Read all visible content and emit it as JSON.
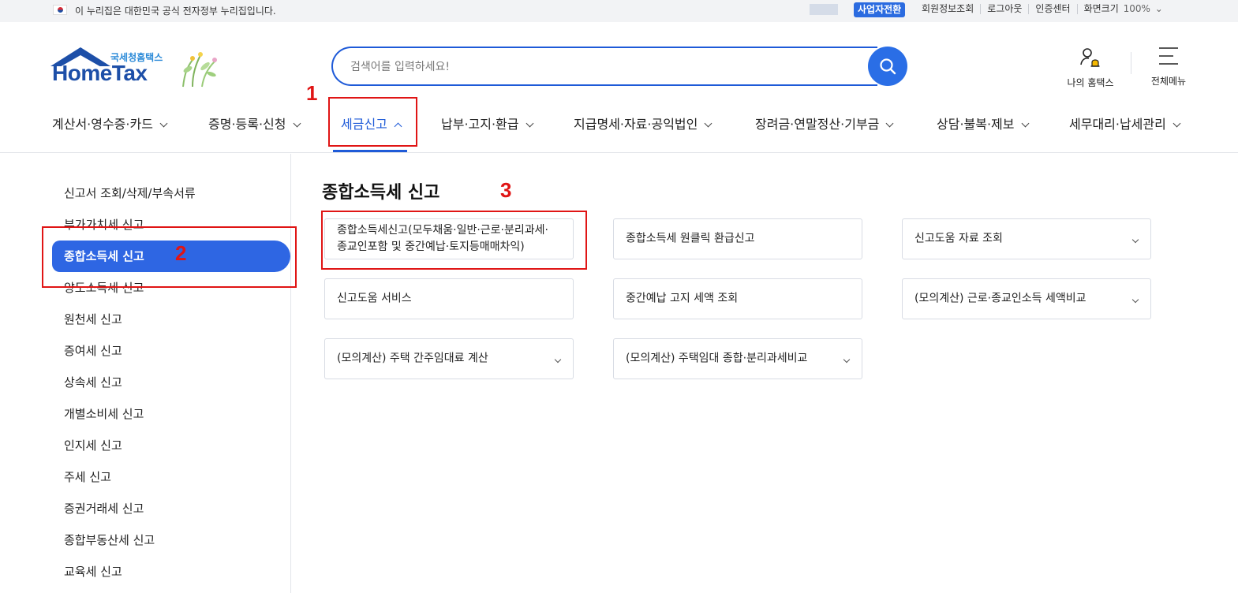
{
  "gov_banner": {
    "text": "이 누리집은 대한민국 공식 전자정부 누리집입니다.",
    "business_switch": "사업자전환",
    "links": [
      "회원정보조회",
      "로그아웃",
      "인증센터",
      "화면크기"
    ],
    "zoom": "100%"
  },
  "logo": {
    "sub": "국세청홈택스",
    "main": "HomeTax"
  },
  "search": {
    "placeholder": "검색어를 입력하세요!"
  },
  "header_actions": {
    "my_home": "나의 홈택스",
    "all_menu": "전체메뉴"
  },
  "gnb": {
    "items": [
      "계산서·영수증·카드",
      "증명·등록·신청",
      "세금신고",
      "납부·고지·환급",
      "지급명세·자료·공익법인",
      "장려금·연말정산·기부금",
      "상담·불복·제보",
      "세무대리·납세관리"
    ],
    "active_index": 2
  },
  "sidebar": {
    "items": [
      "신고서 조회/삭제/부속서류",
      "부가가치세 신고",
      "종합소득세 신고",
      "양도소득세 신고",
      "원천세 신고",
      "증여세 신고",
      "상속세 신고",
      "개별소비세 신고",
      "인지세 신고",
      "주세 신고",
      "증권거래세 신고",
      "종합부동산세 신고",
      "교육세 신고"
    ],
    "active_index": 2
  },
  "content": {
    "title": "종합소득세 신고",
    "cards": [
      {
        "label": "종합소득세신고(모두채움·일반·근로·분리과세·종교인포함 및 중간예납·토지등매매차익)",
        "has_dropdown": false
      },
      {
        "label": "종합소득세 원클릭 환급신고",
        "has_dropdown": false
      },
      {
        "label": "신고도움 자료 조회",
        "has_dropdown": true
      },
      {
        "label": "신고도움 서비스",
        "has_dropdown": false
      },
      {
        "label": "중간예납 고지 세액 조회",
        "has_dropdown": false
      },
      {
        "label": "(모의계산) 근로·종교인소득 세액비교",
        "has_dropdown": true
      },
      {
        "label": "(모의계산) 주택 간주임대료 계산",
        "has_dropdown": true
      },
      {
        "label": "(모의계산) 주택임대 종합·분리과세비교",
        "has_dropdown": true
      }
    ]
  },
  "annotations": {
    "n1": "1",
    "n2": "2",
    "n3": "3",
    "color": "#e01515"
  },
  "colors": {
    "primary": "#1f5bd8",
    "sidebar_active": "#2e66e3",
    "brand": "#1d4fa8"
  }
}
